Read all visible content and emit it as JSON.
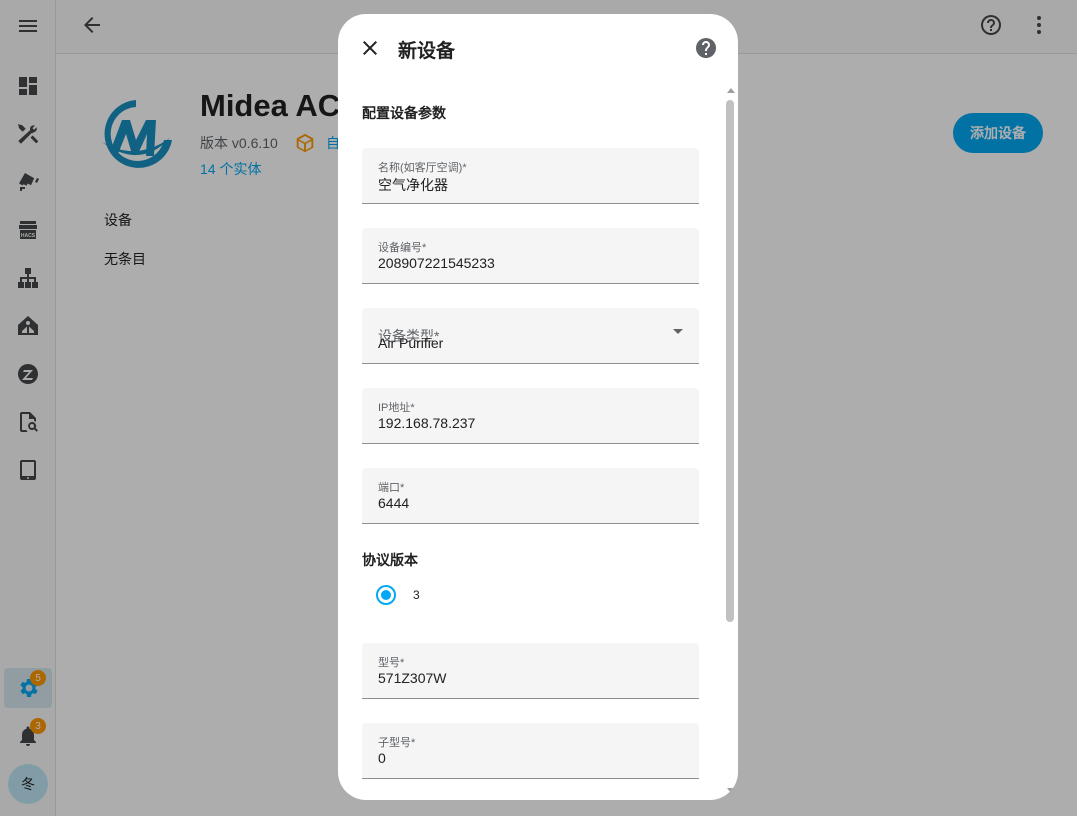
{
  "sidebar": {
    "items": [
      {
        "icon": "dashboard-icon"
      },
      {
        "icon": "tools-icon"
      },
      {
        "icon": "cctv-icon"
      },
      {
        "icon": "hacs-store-icon"
      },
      {
        "icon": "sitemap-icon"
      },
      {
        "icon": "home-assistant-icon"
      },
      {
        "icon": "zigbee-icon"
      },
      {
        "icon": "file-search-icon"
      },
      {
        "icon": "tablet-icon"
      }
    ],
    "settings_badge": "5",
    "notifications_badge": "3",
    "avatar_initial": "冬"
  },
  "topbar": {
    "back_icon": "arrow-left-icon",
    "help_icon": "help-circle-icon",
    "menu_icon": "dots-vertical-icon"
  },
  "integration": {
    "title": "Midea AC",
    "version": "版本 v0.6.10",
    "auto_text": "自",
    "entities_link": "14 个实体",
    "devices_section": "设备",
    "no_items": "无条目",
    "add_device_button": "添加设备"
  },
  "dialog": {
    "title": "新设备",
    "form_heading": "配置设备参数",
    "fields": [
      {
        "label": "名称(如客厅空调)*",
        "value": "空气净化器"
      },
      {
        "label": "设备编号*",
        "value": "208907221545233"
      },
      {
        "label": "设备类型*",
        "value": "Air Purifier"
      },
      {
        "label": "IP地址*",
        "value": "192.168.78.237"
      },
      {
        "label": "端口*",
        "value": "6444"
      },
      {
        "label": "型号*",
        "value": "571Z307W"
      },
      {
        "label": "子型号*",
        "value": "0"
      }
    ],
    "protocol_heading": "协议版本",
    "protocol_option": "3"
  },
  "colors": {
    "accent": "#03a9f4",
    "badge": "#ff9800",
    "scrim": "rgba(0,0,0,0.32)"
  }
}
